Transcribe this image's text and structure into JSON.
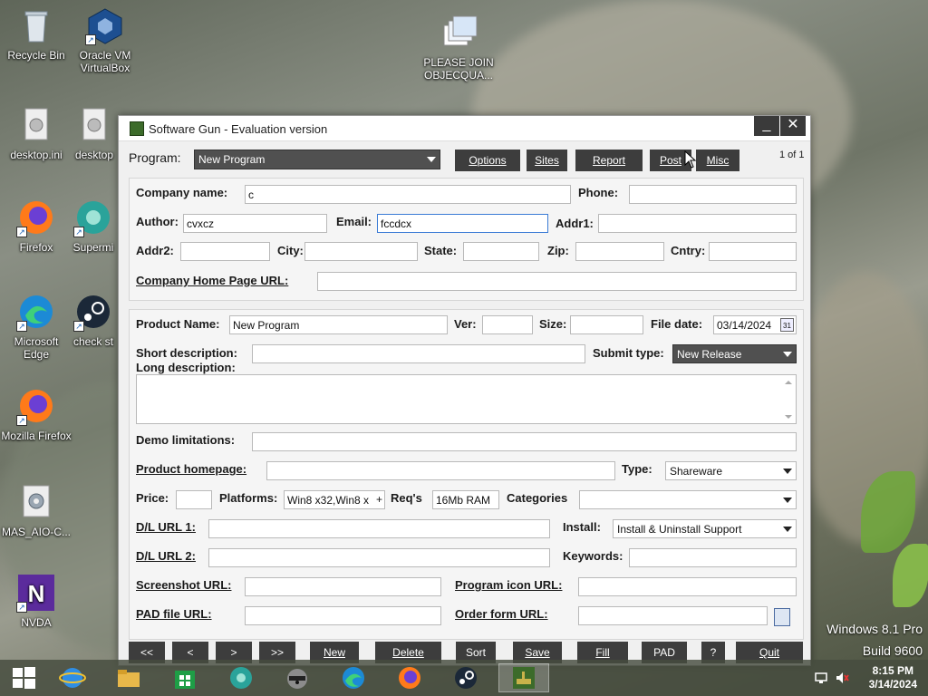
{
  "desktop": {
    "icons": [
      {
        "label": "Recycle Bin"
      },
      {
        "label": "Oracle VM VirtualBox"
      },
      {
        "label": "PLEASE JOIN OBJECQUA..."
      },
      {
        "label": "desktop.ini"
      },
      {
        "label": "desktop"
      },
      {
        "label": "Firefox"
      },
      {
        "label": "Supermi"
      },
      {
        "label": "Microsoft Edge"
      },
      {
        "label": "check st"
      },
      {
        "label": "Mozilla Firefox"
      },
      {
        "label": "MAS_AIO-C..."
      },
      {
        "label": "NVDA"
      }
    ],
    "watermark_line1": "Windows 8.1 Pro",
    "watermark_line2": "Build 9600"
  },
  "window": {
    "title": "Software Gun - Evaluation version",
    "minimize_glyph": "_",
    "close_glyph": "✕",
    "program_label": "Program:",
    "program_value": "New Program",
    "buttons": {
      "options": "Options",
      "sites": "Sites",
      "report": "Report",
      "post": "Post",
      "misc": "Misc"
    },
    "record_counter": "1 of 1",
    "company": {
      "company_name_label": "Company name:",
      "company_name_value": "c",
      "phone_label": "Phone:",
      "phone_value": "",
      "author_label": "Author:",
      "author_value": "cvxcz",
      "email_label": "Email:",
      "email_value": "fccdcx",
      "addr1_label": "Addr1:",
      "addr1_value": "",
      "addr2_label": "Addr2:",
      "city_label": "City:",
      "state_label": "State:",
      "zip_label": "Zip:",
      "cntry_label": "Cntry:",
      "homepage_label": "Company Home Page URL:"
    },
    "product": {
      "product_name_label": "Product Name:",
      "product_name_value": "New Program",
      "ver_label": "Ver:",
      "size_label": "Size:",
      "file_date_label": "File date:",
      "file_date_value": "03/14/2024",
      "calendar_glyph": "31",
      "short_desc_label": "Short description:",
      "long_desc_label": "Long description:",
      "submit_type_label": "Submit type:",
      "submit_type_value": "New Release",
      "demo_label": "Demo limitations:",
      "product_homepage_label": "Product homepage:",
      "type_label": "Type:",
      "type_value": "Shareware",
      "price_label": "Price:",
      "platforms_label": "Platforms:",
      "platforms_value": "Win8 x32,Win8 x",
      "platforms_plus": "+",
      "reqs_label": "Req's",
      "reqs_value": "16Mb RAM",
      "categories_label": "Categories",
      "dl1_label": "D/L URL 1:",
      "install_label": "Install:",
      "install_value": "Install & Uninstall Support",
      "dl2_label": "D/L URL 2:",
      "keywords_label": "Keywords:",
      "screenshot_label": "Screenshot URL:",
      "program_icon_label": "Program icon URL:",
      "pad_label": "PAD file URL:",
      "order_form_label": "Order form URL:"
    },
    "nav": {
      "first": "<<",
      "prev": "<",
      "next": ">",
      "last": ">>",
      "new": "New",
      "delete": "Delete",
      "sort": "Sort",
      "save": "Save",
      "fill": "Fill",
      "pad": "PAD",
      "help": "?",
      "quit": "Quit"
    }
  },
  "taskbar": {
    "time": "8:15 PM",
    "date": "3/14/2024"
  }
}
